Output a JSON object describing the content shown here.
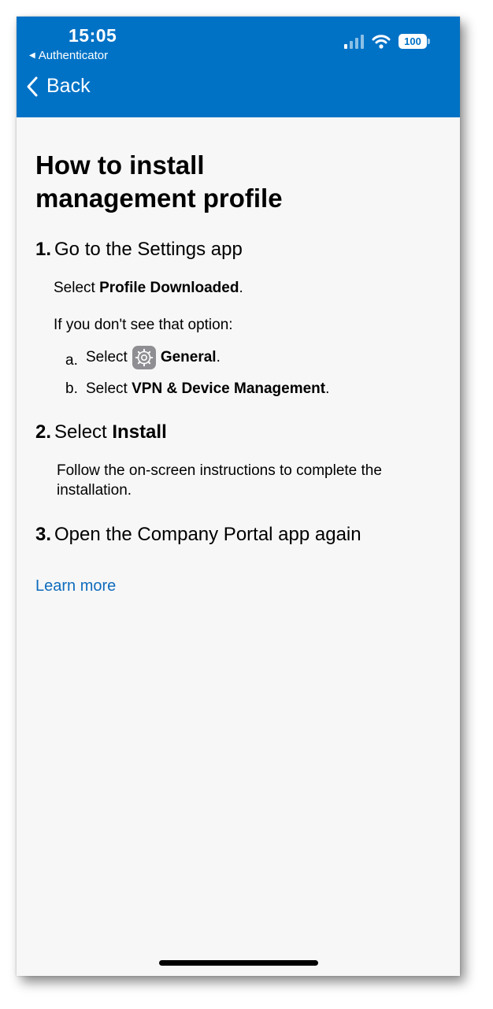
{
  "status_bar": {
    "time": "15:05",
    "back_app": "Authenticator",
    "battery": "100",
    "signal_bars_on": 1,
    "signal_bars_total": 4
  },
  "nav": {
    "back_label": "Back"
  },
  "page": {
    "title_line1": "How to install",
    "title_line2": "management profile",
    "steps": [
      {
        "number": "1.",
        "label": "Go to the Settings app",
        "line1_prefix": "Select ",
        "line1_bold": "Profile Downloaded",
        "line1_suffix": ".",
        "line2": "If you don't see that option:",
        "sub_items": [
          {
            "letter": "a.",
            "prefix": "Select",
            "bold": "General",
            "suffix": ".",
            "icon": "settings-gear-icon"
          },
          {
            "letter": "b.",
            "prefix": "Select ",
            "bold": "VPN & Device Management",
            "suffix": "."
          }
        ]
      },
      {
        "number": "2.",
        "label_prefix": "Select ",
        "label_bold": "Install",
        "desc_line1": "Follow the on-screen instructions to complete the",
        "desc_line2": "installation."
      },
      {
        "number": "3.",
        "label": "Open the Company Portal app again"
      }
    ],
    "learn_more": "Learn more"
  },
  "colors": {
    "header_bg": "#0072c6",
    "link": "#0f6cbd",
    "page_bg": "#f7f7f7"
  }
}
